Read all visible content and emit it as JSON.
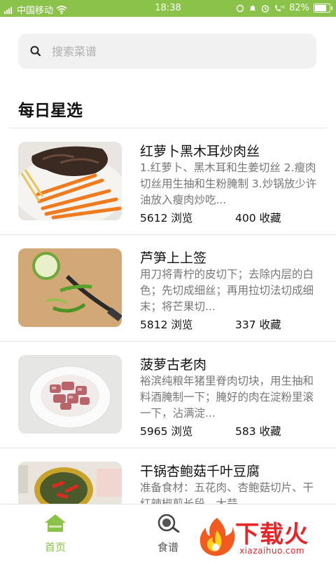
{
  "status_bar": {
    "carrier": "中国移动",
    "time": "18:38",
    "battery": "82%"
  },
  "search": {
    "placeholder": "搜索菜谱"
  },
  "section": {
    "title": "每日星选"
  },
  "recipes": [
    {
      "title": "红萝卜黑木耳炒肉丝",
      "desc": "1.红萝卜、黑木耳和生姜切丝 2.瘦肉切丝用生抽和生粉腌制 3.炒锅放少许油放入瘦肉炒吃...",
      "views": "5612 浏览",
      "favorites": "400 收藏"
    },
    {
      "title": "芦笋上上签",
      "desc": "用刀将青柠的皮切下；去除内层的白色；先切成细丝；再用拉切法切成细末；将芒果切...",
      "views": "5812 浏览",
      "favorites": "337 收藏"
    },
    {
      "title": "菠萝古老肉",
      "desc": "裕滨纯粮年猪里脊肉切块，用生抽和料酒腌制一下；腌好的肉在淀粉里滚一下，沾满淀...",
      "views": "5965 浏览",
      "favorites": "583 收藏"
    },
    {
      "title": "干锅杏鲍菇千叶豆腐",
      "desc": "准备食材：五花肉、杏鲍菇切片、干红辣椒剪长段，大蒜、",
      "views": "",
      "favorites": ""
    }
  ],
  "nav": {
    "home": "首页",
    "recipes": "食谱"
  },
  "watermark": {
    "cn": "下载火",
    "en": "xiazaihuo.com"
  },
  "colors": {
    "accent": "#8bc34a",
    "watermark": "#e8262a"
  }
}
